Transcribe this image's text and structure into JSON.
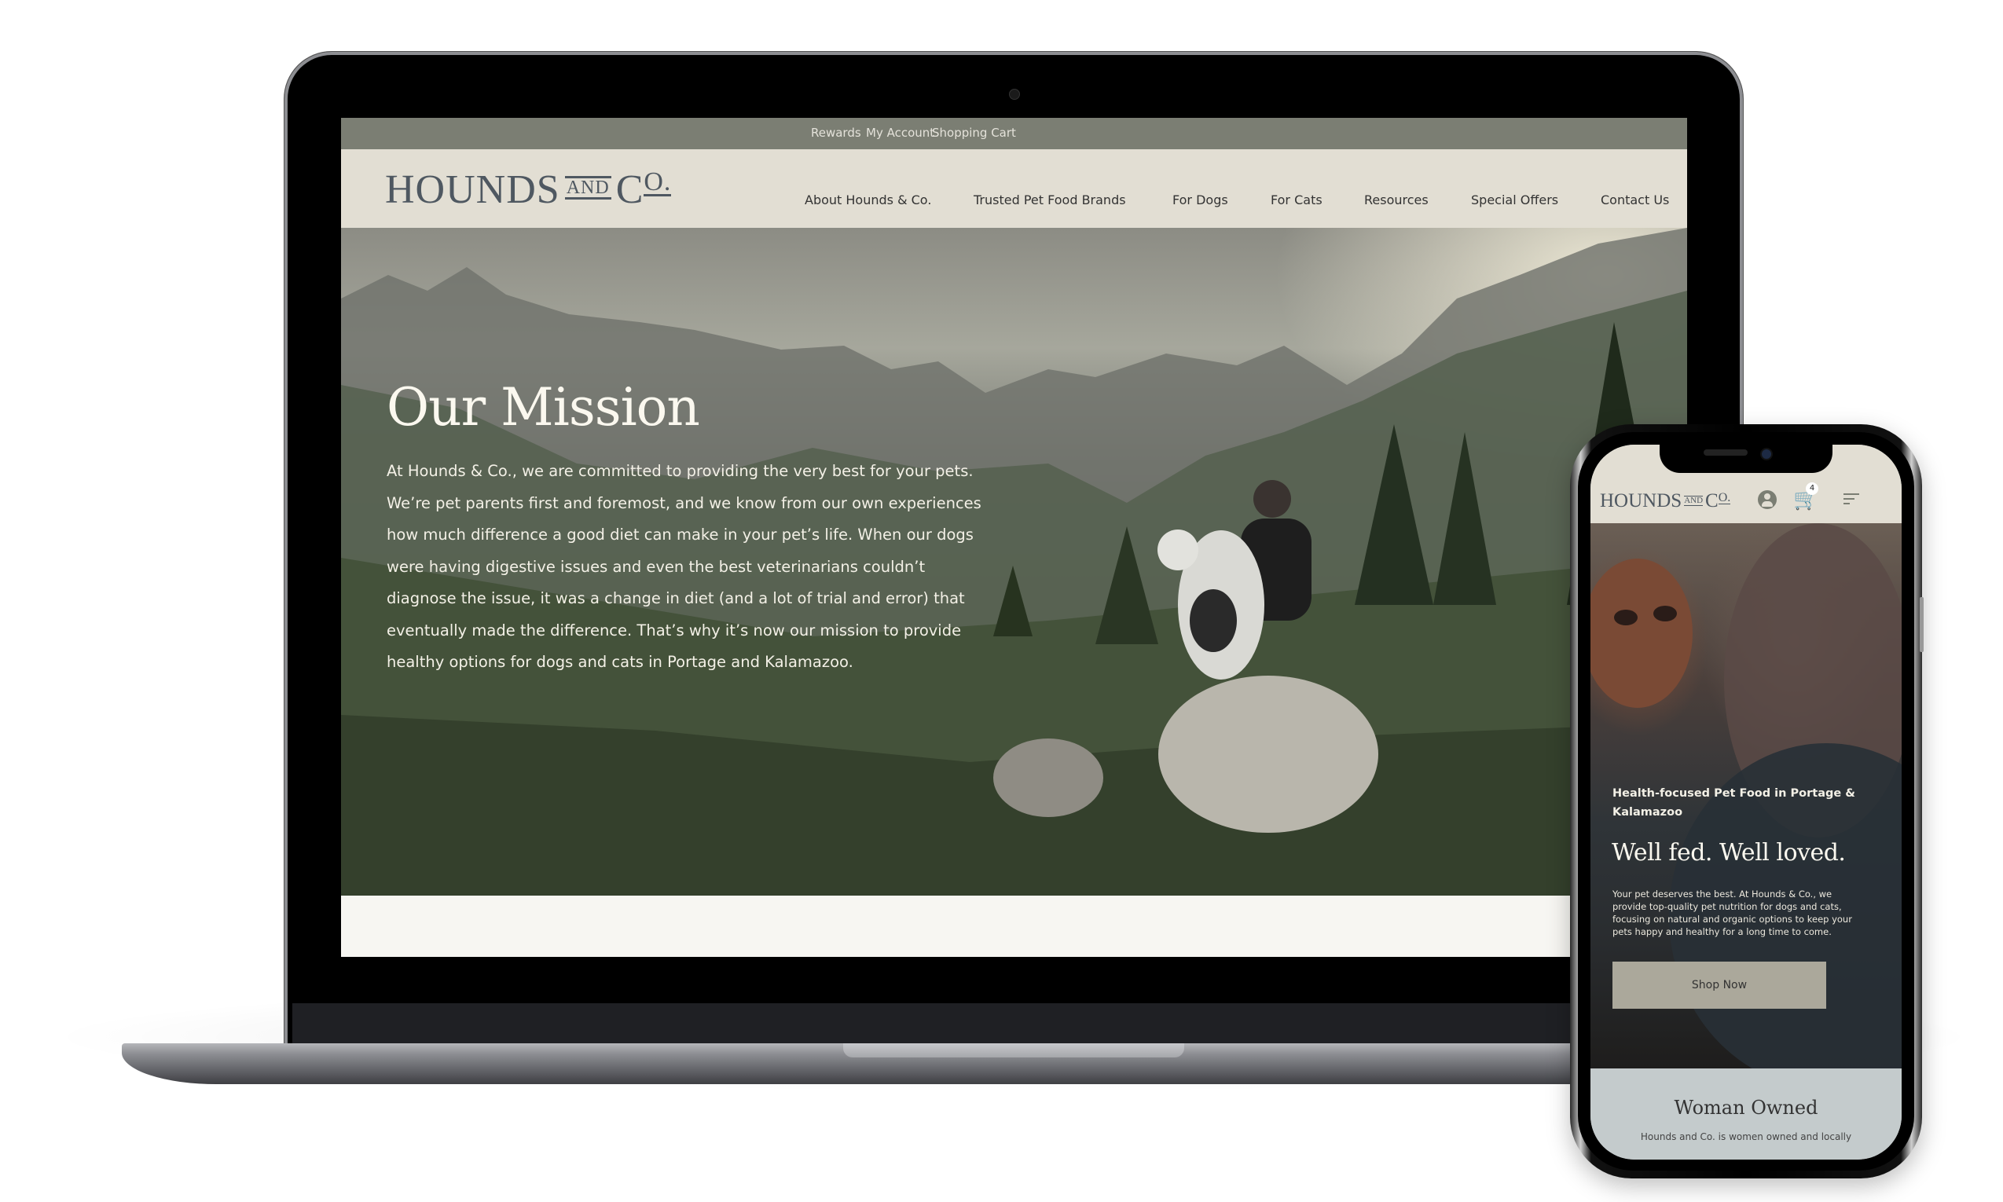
{
  "laptop": {
    "utility_nav": [
      {
        "label": "Rewards"
      },
      {
        "label": "My Account"
      },
      {
        "label": "Shopping Cart"
      }
    ],
    "logo": {
      "main": "HOUNDS",
      "and": "AND",
      "co_c": "C",
      "co_o": "O."
    },
    "main_nav": [
      {
        "label": "About Hounds & Co."
      },
      {
        "label": "Trusted Pet Food Brands"
      },
      {
        "label": "For Dogs"
      },
      {
        "label": "For Cats"
      },
      {
        "label": "Resources"
      },
      {
        "label": "Special Offers"
      },
      {
        "label": "Contact Us"
      }
    ],
    "hero": {
      "title": "Our Mission",
      "body": "At Hounds & Co., we are committed to providing the very best for your pets. We’re pet parents first and foremost, and we know from our own experiences how much difference a good diet can make in your pet’s life. When our dogs were having digestive issues and even the best veterinarians couldn’t diagnose the issue, it was a change in diet (and a lot of trial and error) that eventually made the difference. That’s why it’s now our mission to provide healthy options for dogs and cats in Portage and Kalamazoo."
    }
  },
  "phone": {
    "logo": {
      "main": "HOUNDS",
      "and": "AND",
      "co_c": "C",
      "co_o": "O."
    },
    "icons": {
      "account": "user-circle-icon",
      "cart": "cart-icon",
      "menu": "menu-icon"
    },
    "cart_count": "4",
    "cart_glyph": "🛒",
    "hero": {
      "eyebrow": "Health-focused Pet Food in Portage & Kalamazoo",
      "title": "Well fed. Well loved.",
      "body": "Your pet deserves the best. At Hounds & Co., we provide top-quality pet nutrition for dogs and cats, focusing on natural and organic options to keep your pets happy and healthy for a long time to come.",
      "cta": "Shop Now"
    },
    "section": {
      "title": "Woman Owned",
      "body": "Hounds and Co. is women owned and locally"
    }
  },
  "colors": {
    "utility_bar": "#7b7e73",
    "header_bg": "#e2ded3",
    "logo": "#4f5861",
    "cta_bg": "#aba89b",
    "section_bg": "#c4cbcc"
  }
}
